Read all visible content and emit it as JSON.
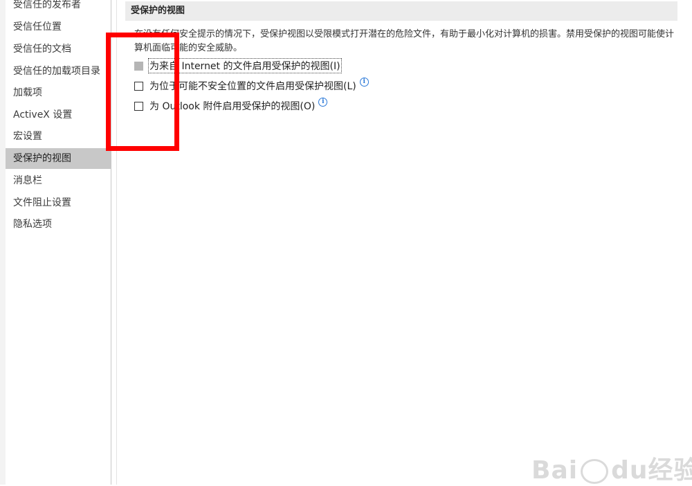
{
  "sidebar": {
    "items": [
      {
        "label": "受信任的发布者",
        "active": false
      },
      {
        "label": "受信任位置",
        "active": false
      },
      {
        "label": "受信任的文档",
        "active": false
      },
      {
        "label": "受信任的加载项目录",
        "active": false
      },
      {
        "label": "加载项",
        "active": false
      },
      {
        "label": "ActiveX 设置",
        "active": false
      },
      {
        "label": "宏设置",
        "active": false
      },
      {
        "label": "受保护的视图",
        "active": true
      },
      {
        "label": "消息栏",
        "active": false
      },
      {
        "label": "文件阻止设置",
        "active": false
      },
      {
        "label": "隐私选项",
        "active": false
      }
    ]
  },
  "main": {
    "section_title": "受保护的视图",
    "description": "在没有任何安全提示的情况下，受保护视图以受限模式打开潜在的危险文件，有助于最小化对计算机的损害。禁用受保护的视图可能使计算机面临可能的安全威胁。",
    "options": [
      {
        "label": "为来自 Internet 的文件启用受保护的视图(I)",
        "checked": false,
        "disabled": true,
        "focused": true,
        "info": false
      },
      {
        "label": "为位于可能不安全位置的文件启用受保护视图(L)",
        "checked": false,
        "disabled": false,
        "focused": false,
        "info": true
      },
      {
        "label": "为 Outlook 附件启用受保护的视图(O)",
        "checked": false,
        "disabled": false,
        "focused": false,
        "info": true
      }
    ],
    "info_glyph": "i"
  },
  "annotation": {
    "color": "#ff0000"
  },
  "watermark": {
    "text_left": "Bai",
    "text_right": "du经验"
  }
}
